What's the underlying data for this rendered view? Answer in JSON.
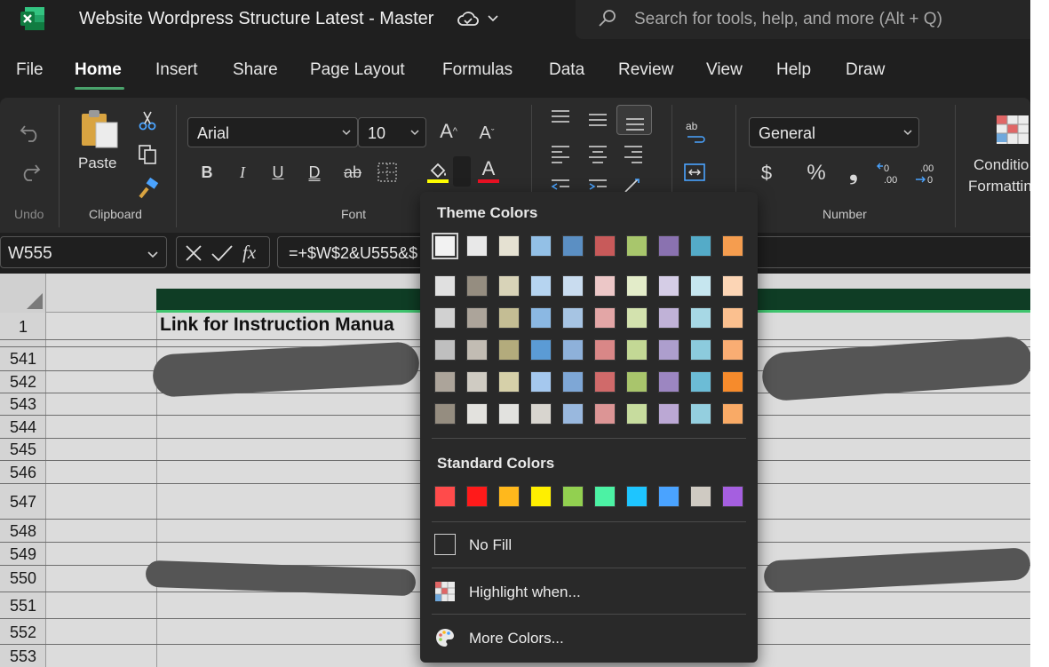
{
  "window": {
    "title": "Website Wordpress Structure Latest - Master",
    "search_placeholder": "Search for tools, help, and more (Alt + Q)"
  },
  "tabs": [
    "File",
    "Home",
    "Insert",
    "Share",
    "Page Layout",
    "Formulas",
    "Data",
    "Review",
    "View",
    "Help",
    "Draw"
  ],
  "active_tab": "Home",
  "ribbon": {
    "undo_label": "Undo",
    "clipboard": {
      "paste_label": "Paste",
      "group_label": "Clipboard"
    },
    "font": {
      "name": "Arial",
      "size": "10",
      "group_label": "Font",
      "bold": "B",
      "italic": "I",
      "underline": "U",
      "double_underline": "D",
      "strike": "ab"
    },
    "number": {
      "format": "General",
      "group_label": "Number",
      "currency": "$",
      "percent": "%",
      "comma": "❟"
    },
    "conditional_formatting_line1": "Conditio",
    "conditional_formatting_line2": "Formattin",
    "colors": {
      "fill_bar": "#ffff00",
      "font_bar": "#e81123",
      "accent": "#4aa36c"
    }
  },
  "formula_bar": {
    "name_box": "W555",
    "formula": "=+$W$2&U555&$"
  },
  "sheet": {
    "header_row_label": "1",
    "header_cell": "Link for Instruction Manua",
    "row_numbers": [
      "541",
      "542",
      "543",
      "544",
      "545",
      "546",
      "547",
      "548",
      "549",
      "550",
      "551",
      "552",
      "553"
    ]
  },
  "fill_menu": {
    "theme_colors_label": "Theme Colors",
    "theme_top": [
      "#f2f2f2",
      "#e8e8e8",
      "#e5e1d2",
      "#93c0e6",
      "#5b8fc3",
      "#c85a5a",
      "#a8c66c",
      "#8a72b0",
      "#54abc8",
      "#f59d4f"
    ],
    "theme_rows": [
      [
        "#e0e0e0",
        "#958d80",
        "#d8d3b8",
        "#b6d4f0",
        "#c9dcef",
        "#ecc7c7",
        "#e3ecc9",
        "#d5cde6",
        "#c6e6ef",
        "#fcd5b5"
      ],
      [
        "#d1d1d1",
        "#aca49a",
        "#c4bd94",
        "#8bb8e3",
        "#a6c4e3",
        "#e3a6a6",
        "#d3e2ae",
        "#c0b2d7",
        "#a7d8e5",
        "#fbc08f"
      ],
      [
        "#bfbfbf",
        "#c2bcb3",
        "#b3ab7c",
        "#5b9bd5",
        "#8eb1da",
        "#d98787",
        "#c3d895",
        "#ad9ecd",
        "#8ccbdd",
        "#f9ad73"
      ],
      [
        "#aca49a",
        "#cfcbc2",
        "#d6d0a9",
        "#a5c8ee",
        "#7ea7d6",
        "#d06a6a",
        "#a9c56c",
        "#9c86c1",
        "#6cbcd6",
        "#f68b2c"
      ],
      [
        "#958d80",
        "#e3e2de",
        "#e2e2df",
        "#d8d5cf",
        "#99b8de",
        "#dc9595",
        "#c7dc9e",
        "#bba8d4",
        "#94cfdf",
        "#f9aa66"
      ]
    ],
    "standard_colors_label": "Standard Colors",
    "standard": [
      "#ff4b4b",
      "#ff1a1a",
      "#ffb81c",
      "#ffef00",
      "#92d050",
      "#4cf2a4",
      "#1ec5ff",
      "#4aa3ff",
      "#cfcac2",
      "#a55fe0"
    ],
    "no_fill_label": "No Fill",
    "highlight_label": "Highlight when...",
    "more_colors_label": "More Colors..."
  }
}
